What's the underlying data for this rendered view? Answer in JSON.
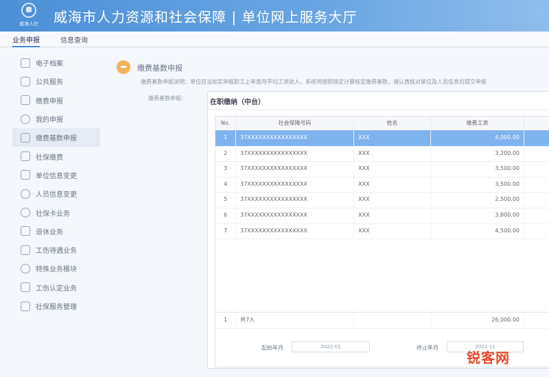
{
  "header": {
    "title": "威海市人力资源和社会保障 | 单位网上服务大厅",
    "logo_text": "威海人社"
  },
  "tabs": [
    {
      "label": "业务申报",
      "active": true
    },
    {
      "label": "信息查询",
      "active": false
    }
  ],
  "sidebar": {
    "items": [
      {
        "label": "电子档案",
        "icon": "clipboard-icon",
        "active": false
      },
      {
        "label": "公共服务",
        "icon": "document-icon",
        "active": false
      },
      {
        "label": "缴费申报",
        "icon": "document-icon",
        "active": false
      },
      {
        "label": "我的申报",
        "icon": "user-icon",
        "active": false
      },
      {
        "label": "缴费基数申报",
        "icon": "document-icon",
        "active": true
      },
      {
        "label": "社保缴费",
        "icon": "card-icon",
        "active": false
      },
      {
        "label": "单位信息变更",
        "icon": "edit-icon",
        "active": false
      },
      {
        "label": "人员信息变更",
        "icon": "user-edit-icon",
        "active": false
      },
      {
        "label": "社保卡业务",
        "icon": "cloud-icon",
        "active": false
      },
      {
        "label": "退休业务",
        "icon": "edit-icon",
        "active": false
      },
      {
        "label": "工伤待遇业务",
        "icon": "document-icon",
        "active": false
      },
      {
        "label": "特殊业务模块",
        "icon": "user-icon",
        "active": false
      },
      {
        "label": "工伤认定业务",
        "icon": "document-icon",
        "active": false
      },
      {
        "label": "社保服务管理",
        "icon": "edit-icon",
        "active": false
      }
    ]
  },
  "section": {
    "title": "缴费基数申报",
    "notice": "缴费基数申报说明：单位应当如实申报职工上年度月平均工资收入，系统将按照规定计算核定缴费基数，请认真核对单位及人员信息后提交申报"
  },
  "form": {
    "field_label": "缴费基数申报："
  },
  "panel": {
    "title": "在职缴纳（中台）",
    "columns": [
      "No.",
      "社会保障号码",
      "姓名",
      "缴费工资"
    ],
    "rows": [
      {
        "no": "1",
        "id": "37XXXXXXXXXXXXXXXX",
        "name": "XXX",
        "wage": "4,000.00"
      },
      {
        "no": "2",
        "id": "37XXXXXXXXXXXXXXXX",
        "name": "XXX",
        "wage": "3,200.00"
      },
      {
        "no": "3",
        "id": "37XXXXXXXXXXXXXXXX",
        "name": "XXX",
        "wage": "3,500.00"
      },
      {
        "no": "4",
        "id": "37XXXXXXXXXXXXXXXX",
        "name": "XXX",
        "wage": "3,500.00"
      },
      {
        "no": "5",
        "id": "37XXXXXXXXXXXXXXXX",
        "name": "XXX",
        "wage": "2,500.00"
      },
      {
        "no": "6",
        "id": "37XXXXXXXXXXXXXXXX",
        "name": "XXX",
        "wage": "3,800.00"
      },
      {
        "no": "7",
        "id": "37XXXXXXXXXXXXXXXX",
        "name": "XXX",
        "wage": "4,500.00"
      }
    ],
    "total": {
      "no": "1",
      "label": "共7人",
      "wage": "26,000.00"
    },
    "start_label": "起始年月",
    "start_value": "2022-01",
    "end_label": "终止年月",
    "end_value": "2022-12"
  },
  "watermark": {
    "text": "锐客网"
  },
  "colors": {
    "header": "#5b9bde",
    "selected_row": "#7fb3ee",
    "accent_icon": "#f2b35b",
    "watermark": "#e64b2a"
  }
}
